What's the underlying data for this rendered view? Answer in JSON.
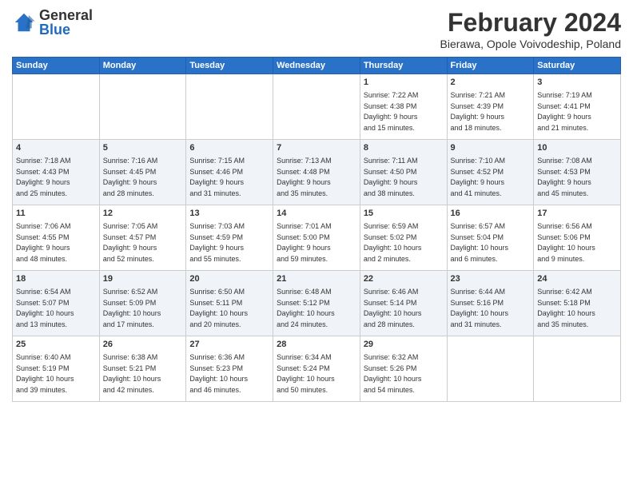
{
  "logo": {
    "general": "General",
    "blue": "Blue"
  },
  "header": {
    "month": "February 2024",
    "location": "Bierawa, Opole Voivodeship, Poland"
  },
  "days_of_week": [
    "Sunday",
    "Monday",
    "Tuesday",
    "Wednesday",
    "Thursday",
    "Friday",
    "Saturday"
  ],
  "weeks": [
    [
      {
        "day": "",
        "info": ""
      },
      {
        "day": "",
        "info": ""
      },
      {
        "day": "",
        "info": ""
      },
      {
        "day": "",
        "info": ""
      },
      {
        "day": "1",
        "info": "Sunrise: 7:22 AM\nSunset: 4:38 PM\nDaylight: 9 hours\nand 15 minutes."
      },
      {
        "day": "2",
        "info": "Sunrise: 7:21 AM\nSunset: 4:39 PM\nDaylight: 9 hours\nand 18 minutes."
      },
      {
        "day": "3",
        "info": "Sunrise: 7:19 AM\nSunset: 4:41 PM\nDaylight: 9 hours\nand 21 minutes."
      }
    ],
    [
      {
        "day": "4",
        "info": "Sunrise: 7:18 AM\nSunset: 4:43 PM\nDaylight: 9 hours\nand 25 minutes."
      },
      {
        "day": "5",
        "info": "Sunrise: 7:16 AM\nSunset: 4:45 PM\nDaylight: 9 hours\nand 28 minutes."
      },
      {
        "day": "6",
        "info": "Sunrise: 7:15 AM\nSunset: 4:46 PM\nDaylight: 9 hours\nand 31 minutes."
      },
      {
        "day": "7",
        "info": "Sunrise: 7:13 AM\nSunset: 4:48 PM\nDaylight: 9 hours\nand 35 minutes."
      },
      {
        "day": "8",
        "info": "Sunrise: 7:11 AM\nSunset: 4:50 PM\nDaylight: 9 hours\nand 38 minutes."
      },
      {
        "day": "9",
        "info": "Sunrise: 7:10 AM\nSunset: 4:52 PM\nDaylight: 9 hours\nand 41 minutes."
      },
      {
        "day": "10",
        "info": "Sunrise: 7:08 AM\nSunset: 4:53 PM\nDaylight: 9 hours\nand 45 minutes."
      }
    ],
    [
      {
        "day": "11",
        "info": "Sunrise: 7:06 AM\nSunset: 4:55 PM\nDaylight: 9 hours\nand 48 minutes."
      },
      {
        "day": "12",
        "info": "Sunrise: 7:05 AM\nSunset: 4:57 PM\nDaylight: 9 hours\nand 52 minutes."
      },
      {
        "day": "13",
        "info": "Sunrise: 7:03 AM\nSunset: 4:59 PM\nDaylight: 9 hours\nand 55 minutes."
      },
      {
        "day": "14",
        "info": "Sunrise: 7:01 AM\nSunset: 5:00 PM\nDaylight: 9 hours\nand 59 minutes."
      },
      {
        "day": "15",
        "info": "Sunrise: 6:59 AM\nSunset: 5:02 PM\nDaylight: 10 hours\nand 2 minutes."
      },
      {
        "day": "16",
        "info": "Sunrise: 6:57 AM\nSunset: 5:04 PM\nDaylight: 10 hours\nand 6 minutes."
      },
      {
        "day": "17",
        "info": "Sunrise: 6:56 AM\nSunset: 5:06 PM\nDaylight: 10 hours\nand 9 minutes."
      }
    ],
    [
      {
        "day": "18",
        "info": "Sunrise: 6:54 AM\nSunset: 5:07 PM\nDaylight: 10 hours\nand 13 minutes."
      },
      {
        "day": "19",
        "info": "Sunrise: 6:52 AM\nSunset: 5:09 PM\nDaylight: 10 hours\nand 17 minutes."
      },
      {
        "day": "20",
        "info": "Sunrise: 6:50 AM\nSunset: 5:11 PM\nDaylight: 10 hours\nand 20 minutes."
      },
      {
        "day": "21",
        "info": "Sunrise: 6:48 AM\nSunset: 5:12 PM\nDaylight: 10 hours\nand 24 minutes."
      },
      {
        "day": "22",
        "info": "Sunrise: 6:46 AM\nSunset: 5:14 PM\nDaylight: 10 hours\nand 28 minutes."
      },
      {
        "day": "23",
        "info": "Sunrise: 6:44 AM\nSunset: 5:16 PM\nDaylight: 10 hours\nand 31 minutes."
      },
      {
        "day": "24",
        "info": "Sunrise: 6:42 AM\nSunset: 5:18 PM\nDaylight: 10 hours\nand 35 minutes."
      }
    ],
    [
      {
        "day": "25",
        "info": "Sunrise: 6:40 AM\nSunset: 5:19 PM\nDaylight: 10 hours\nand 39 minutes."
      },
      {
        "day": "26",
        "info": "Sunrise: 6:38 AM\nSunset: 5:21 PM\nDaylight: 10 hours\nand 42 minutes."
      },
      {
        "day": "27",
        "info": "Sunrise: 6:36 AM\nSunset: 5:23 PM\nDaylight: 10 hours\nand 46 minutes."
      },
      {
        "day": "28",
        "info": "Sunrise: 6:34 AM\nSunset: 5:24 PM\nDaylight: 10 hours\nand 50 minutes."
      },
      {
        "day": "29",
        "info": "Sunrise: 6:32 AM\nSunset: 5:26 PM\nDaylight: 10 hours\nand 54 minutes."
      },
      {
        "day": "",
        "info": ""
      },
      {
        "day": "",
        "info": ""
      }
    ]
  ]
}
